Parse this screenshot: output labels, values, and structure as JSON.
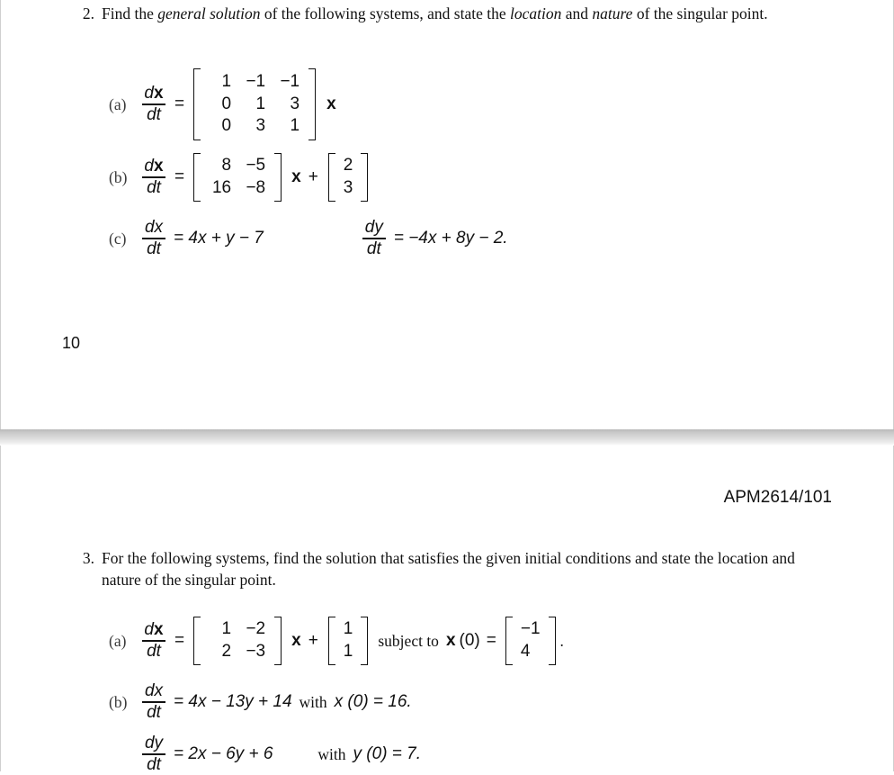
{
  "document": {
    "course_code": "APM2614/101",
    "page_number": "10"
  },
  "page1": {
    "question2": {
      "number": "2.",
      "text_part1": "Find the ",
      "italic1": "general solution",
      "text_part2": " of the following systems, and state the ",
      "italic2": "location",
      "text_part3": " and ",
      "italic3": "nature",
      "text_part4": " of the singular point."
    },
    "item_a": {
      "label": "(a)",
      "frac_num_d": "d",
      "frac_num_var": "x",
      "frac_den": "dt",
      "equals": "=",
      "matrix": [
        [
          "1",
          "−1",
          "−1"
        ],
        [
          "0",
          "1",
          "3"
        ],
        [
          "0",
          "3",
          "1"
        ]
      ],
      "vector_var": "x"
    },
    "item_b": {
      "label": "(b)",
      "frac_num_d": "d",
      "frac_num_var": "x",
      "frac_den": "dt",
      "equals": "=",
      "matrix": [
        [
          "8",
          "−5"
        ],
        [
          "16",
          "−8"
        ]
      ],
      "vector_var": "x",
      "plus": "+",
      "const_vector": [
        [
          "2"
        ],
        [
          "3"
        ]
      ]
    },
    "item_c": {
      "label": "(c)",
      "frac1_num_d": "d",
      "frac1_num_var": "x",
      "frac1_den": "dt",
      "equation1": "= 4x + y − 7",
      "frac2_num_d": "d",
      "frac2_num_var": "y",
      "frac2_den": "dt",
      "equation2": "= −4x + 8y − 2."
    }
  },
  "page2": {
    "question3": {
      "number": "3.",
      "text": "For the following systems, find the solution that satisfies the given initial conditions and state the location and nature of the singular point."
    },
    "item_a": {
      "label": "(a)",
      "frac_num_d": "d",
      "frac_num_var": "x",
      "frac_den": "dt",
      "equals": "=",
      "matrix": [
        [
          "1",
          "−2"
        ],
        [
          "2",
          "−3"
        ]
      ],
      "vector_var": "x",
      "plus": "+",
      "const_vector": [
        [
          "1"
        ],
        [
          "1"
        ]
      ],
      "condition_words": "subject to",
      "condition_var": "x",
      "condition_arg": "(0)",
      "condition_equals": "=",
      "initial_vector": [
        [
          "−1"
        ],
        [
          "4"
        ]
      ],
      "period": "."
    },
    "item_b": {
      "label": "(b)",
      "line1": {
        "frac_num_d": "d",
        "frac_num_var": "x",
        "frac_den": "dt",
        "equation": "= 4x − 13y + 14",
        "with_word": "with",
        "condition": "x (0) = 16."
      },
      "line2": {
        "frac_num_d": "d",
        "frac_num_var": "y",
        "frac_den": "dt",
        "equation": "= 2x − 6y + 6",
        "with_word": "with",
        "condition": "y (0) = 7."
      }
    }
  }
}
